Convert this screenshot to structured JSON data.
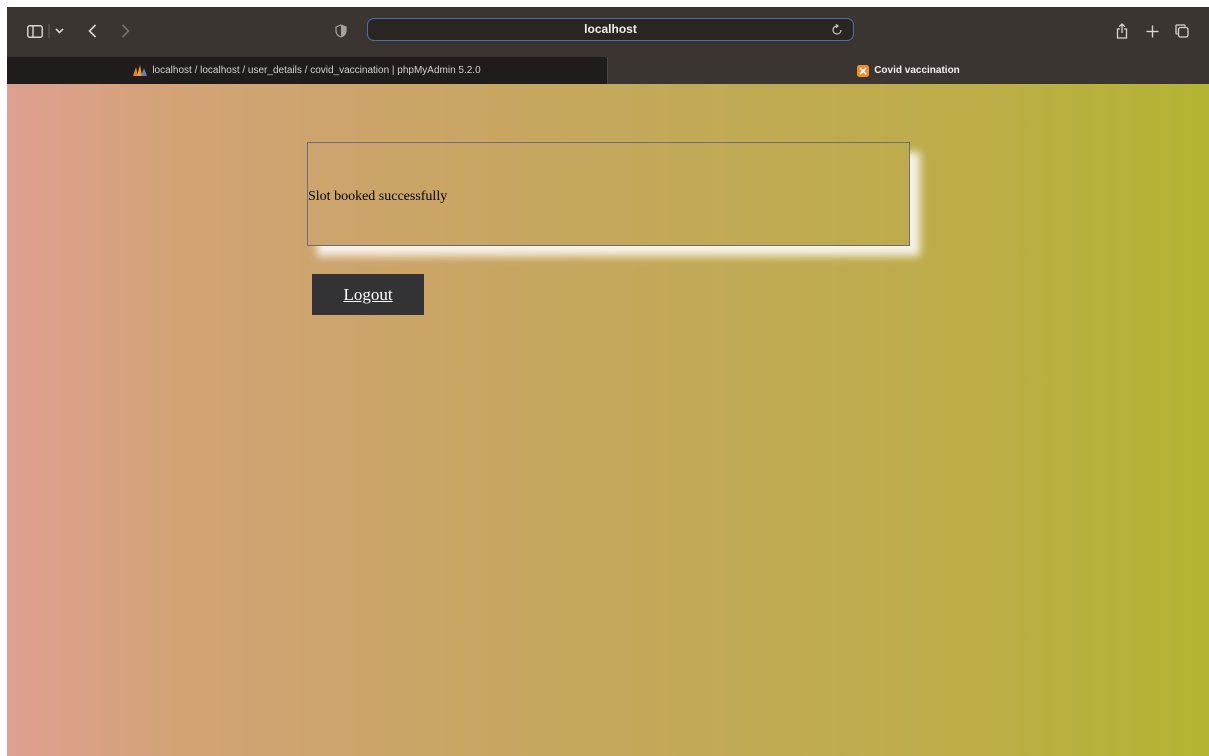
{
  "browser": {
    "address": "localhost",
    "icons": {
      "sidebar": "sidebar-icon",
      "sidebar_menu": "chevron-down-icon",
      "back": "back-icon",
      "forward": "forward-icon",
      "privacy": "shield-icon",
      "reload": "reload-icon",
      "share": "share-icon",
      "new_tab": "plus-icon",
      "tab_overview": "tabs-icon"
    }
  },
  "tabs": [
    {
      "title": "localhost / localhost / user_details / covid_vaccination | phpMyAdmin 5.2.0",
      "active": false,
      "favicon": "phpmyadmin-icon"
    },
    {
      "title": "Covid vaccination",
      "active": true,
      "favicon": "xampp-icon"
    }
  ],
  "page": {
    "message": "Slot booked successfully",
    "logout_label": "Logout",
    "colors": {
      "gradient_start": "#dea091",
      "gradient_end": "#b4b432",
      "button_bg": "#333234",
      "button_text": "#ffffff"
    }
  }
}
